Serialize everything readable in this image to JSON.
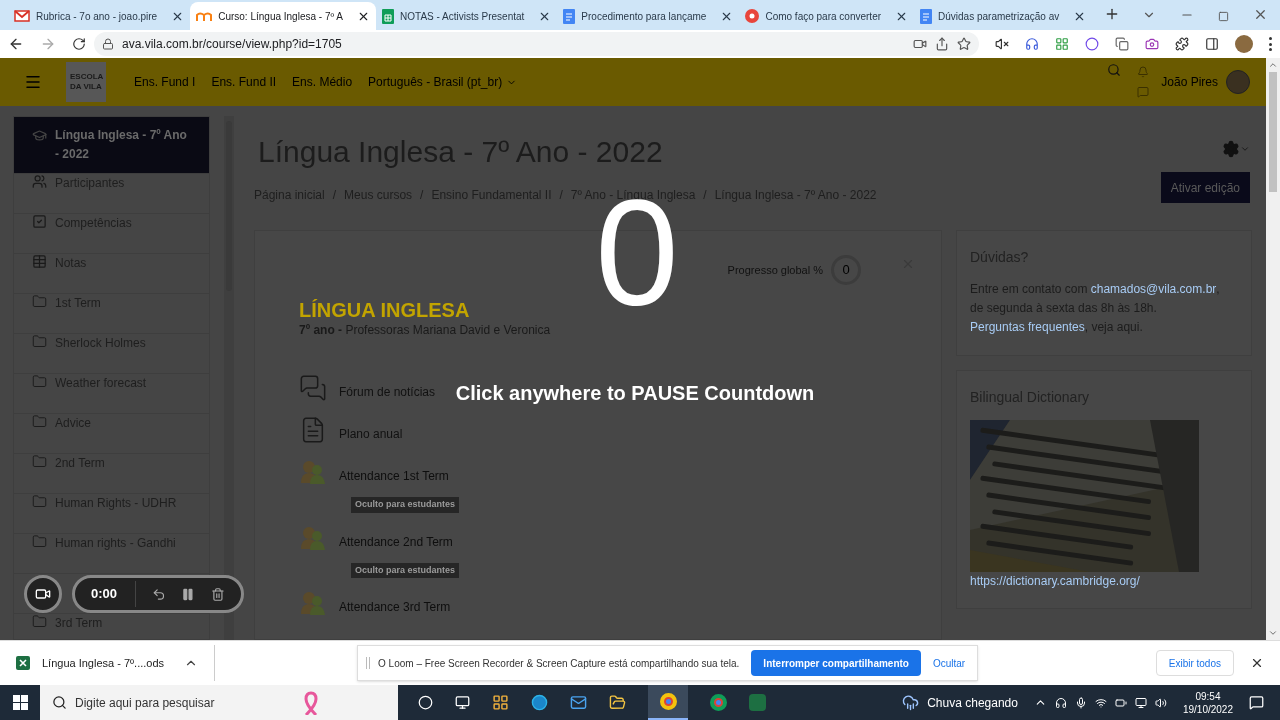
{
  "browser": {
    "tabs": [
      {
        "kind": "gmail",
        "title": "Rubrica - 7o ano - joao.pire",
        "selected": false
      },
      {
        "kind": "moodle",
        "title": "Curso: Língua Inglesa - 7º A",
        "selected": true
      },
      {
        "kind": "sheets",
        "title": "NOTAS - Activists Presentat",
        "selected": false
      },
      {
        "kind": "docs",
        "title": "Procedimento para lançame",
        "selected": false
      },
      {
        "kind": "loom",
        "title": "Como faço para converter",
        "selected": false
      },
      {
        "kind": "docs",
        "title": "Dúvidas parametrização av",
        "selected": false
      }
    ],
    "address": "ava.vila.com.br/course/view.php?id=1705"
  },
  "header": {
    "logo": [
      "ESCOLA",
      "DA VILA"
    ],
    "nav": [
      "Ens. Fund I",
      "Ens. Fund II",
      "Ens. Médio"
    ],
    "language": "Português - Brasil (pt_br)",
    "user": "João Pires"
  },
  "sidebar": {
    "items": [
      {
        "kind": "course",
        "label": "Língua Inglesa - 7º Ano - 2022",
        "selected": true
      },
      {
        "kind": "participants",
        "label": "Participantes",
        "selected": false
      },
      {
        "kind": "competencies",
        "label": "Competências",
        "selected": false
      },
      {
        "kind": "grades",
        "label": "Notas",
        "selected": false
      },
      {
        "kind": "folder",
        "label": "1st Term",
        "selected": false
      },
      {
        "kind": "folder",
        "label": "Sherlock Holmes",
        "selected": false
      },
      {
        "kind": "folder",
        "label": "Weather forecast",
        "selected": false
      },
      {
        "kind": "folder",
        "label": "Advice",
        "selected": false
      },
      {
        "kind": "folder",
        "label": "2nd Term",
        "selected": false
      },
      {
        "kind": "folder",
        "label": "Human Rights - UDHR",
        "selected": false
      },
      {
        "kind": "folder",
        "label": "Human rights - Gandhi",
        "selected": false
      },
      {
        "kind": "folder",
        "label": "3rd Term",
        "selected": false
      }
    ]
  },
  "page": {
    "title": "Língua Inglesa - 7º Ano - 2022",
    "breadcrumb_separator": "/",
    "breadcrumb": [
      "Página inicial",
      "Meus cursos",
      "Ensino Fundamental II",
      "7º Ano - Língua Inglesa",
      "Língua Inglesa - 7º Ano - 2022"
    ],
    "edit_button": "Ativar edição",
    "progress": {
      "label": "Progresso global %",
      "value": "0"
    },
    "banner": {
      "title": "LÍNGUA INGLESA",
      "subtitle": "**7º ano -** Professoras Mariana David e Veronica"
    },
    "activities": [
      {
        "kind": "forum",
        "label": "Fórum de notícias"
      },
      {
        "kind": "page",
        "label": "Plano anual"
      },
      {
        "kind": "attendance",
        "label": "Attendance 1st Term",
        "hidden_badge": "Oculto para estudantes"
      },
      {
        "kind": "attendance",
        "label": "Attendance 2nd Term",
        "hidden_badge": "Oculto para estudantes"
      },
      {
        "kind": "attendance",
        "label": "Attendance 3rd Term"
      }
    ]
  },
  "blocks": [
    {
      "kind": "text",
      "title": "Dúvidas?",
      "lines": [
        [
          {
            "text": "Entre em contato com ",
            "link": false
          },
          {
            "text": "chamados@vila.com.br",
            "link": true
          },
          {
            "text": ",",
            "link": false
          }
        ],
        [
          {
            "text": "de segunda à sexta das 8h às 18h.",
            "link": false
          }
        ],
        [
          {
            "text": "Perguntas frequentes",
            "link": true
          },
          {
            "text": ", veja aqui.",
            "link": false
          }
        ]
      ]
    },
    {
      "title": "Bilingual Dictionary",
      "link": "https://dictionary.cambridge.org/"
    }
  ],
  "countdown": {
    "number": "0",
    "message": "Click anywhere to PAUSE Countdown"
  },
  "recorder": {
    "time": "0:00"
  },
  "downloads": {
    "file": "Língua Inglesa - 7º....ods",
    "show_all": "Exibir todos"
  },
  "share_notice": {
    "text": "O Loom – Free Screen Recorder & Screen Capture está compartilhando sua tela.",
    "stop_button": "Interromper compartilhamento",
    "hide_link": "Ocultar"
  },
  "taskbar": {
    "search_placeholder": "Digite aqui para pesquisar",
    "weather": "Chuva chegando",
    "time": "09:54",
    "date": "19/10/2022"
  }
}
